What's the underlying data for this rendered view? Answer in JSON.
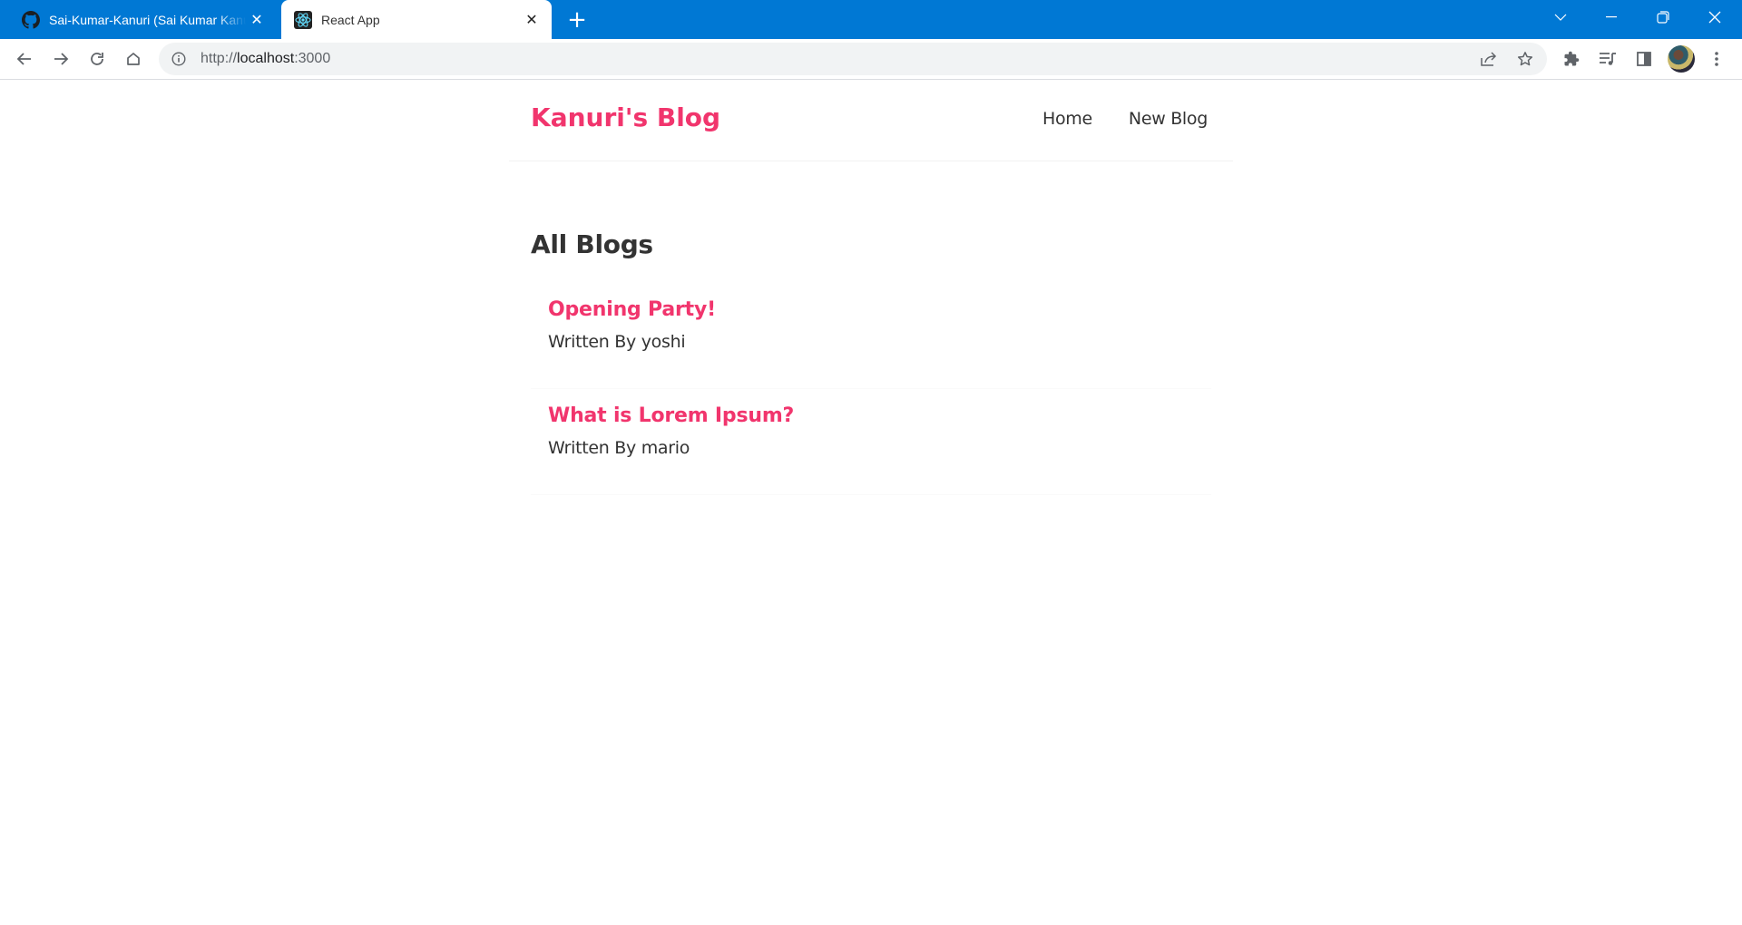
{
  "browser": {
    "tabs": [
      {
        "title": "Sai-Kumar-Kanuri (Sai Kumar Kanuri)",
        "icon": "github-icon",
        "active": false
      },
      {
        "title": "React App",
        "icon": "react-icon",
        "active": true
      }
    ],
    "new_tab_label": "+",
    "url_scheme": "http://",
    "url_host": "localhost",
    "url_port": ":3000",
    "colors": {
      "tabbar": "#0078d4",
      "omnibox": "#f1f3f4"
    }
  },
  "site": {
    "brand": "Kanuri's Blog",
    "nav": [
      {
        "label": "Home"
      },
      {
        "label": "New Blog"
      }
    ],
    "accent_color": "#f1356d"
  },
  "main": {
    "heading": "All Blogs",
    "blogs": [
      {
        "title": "Opening Party!",
        "author_line": "Written By yoshi"
      },
      {
        "title": "What is Lorem Ipsum?",
        "author_line": "Written By mario"
      }
    ]
  }
}
